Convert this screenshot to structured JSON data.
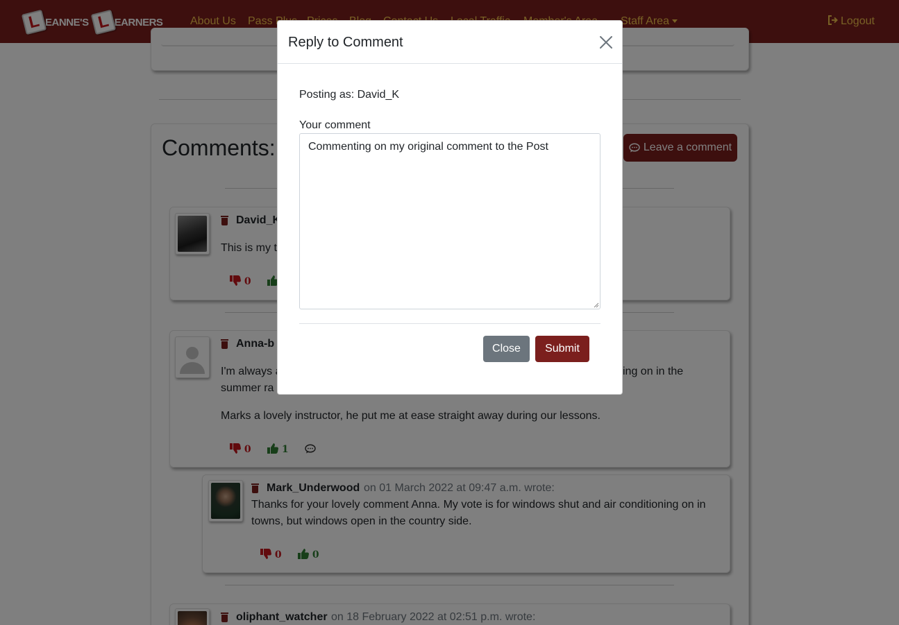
{
  "navbar": {
    "brand": {
      "word1": "EANNE'S",
      "word2": "EARNERS",
      "plate_letter": "L"
    },
    "links": [
      {
        "label": "About Us"
      },
      {
        "label": "Pass Plus"
      },
      {
        "label": "Prices"
      },
      {
        "label": "Blog"
      },
      {
        "label": "Contact Us"
      },
      {
        "label": "Local Traffic"
      },
      {
        "label": "Member's Area"
      }
    ],
    "staff_area": "Staff Area",
    "logout": "Logout"
  },
  "comments_section": {
    "title": "Comments:",
    "leave_comment_button": "Leave a comment",
    "comments": [
      {
        "username": "David_K",
        "text_fragment": "This is my t",
        "downvotes": "0"
      },
      {
        "username": "Anna-b",
        "text_line1_start": "I'm always a",
        "text_line1_end": "ing on in the",
        "text_line2_start": "summer ra",
        "text_para2": "Marks a lovely instructor, he put me at ease straight away during our lessons.",
        "downvotes": "0",
        "upvotes": "1"
      },
      {
        "username": "Mark_Underwood",
        "meta": "on 01 March 2022 at 09:47 a.m. wrote:",
        "text": "Thanks for your lovely comment Anna. My vote is for windows shut and air conditioning on in towns, but windows open in the country side.",
        "downvotes": "0",
        "upvotes": "0"
      },
      {
        "username": "oliphant_watcher",
        "meta": "on 18 February 2022 at 02:51 p.m. wrote:"
      }
    ]
  },
  "modal": {
    "title": "Reply to Comment",
    "posting_as": "Posting as: David_K",
    "comment_label": "Your comment",
    "comment_value": "Commenting on my original comment to the Post",
    "close_button": "Close",
    "submit_button": "Submit"
  },
  "colors": {
    "brand": "#7b1f1d",
    "nav_link": "#f0c14b",
    "downvote": "#c4161c",
    "upvote": "#2e7d32",
    "secondary_button": "#6c757d"
  }
}
